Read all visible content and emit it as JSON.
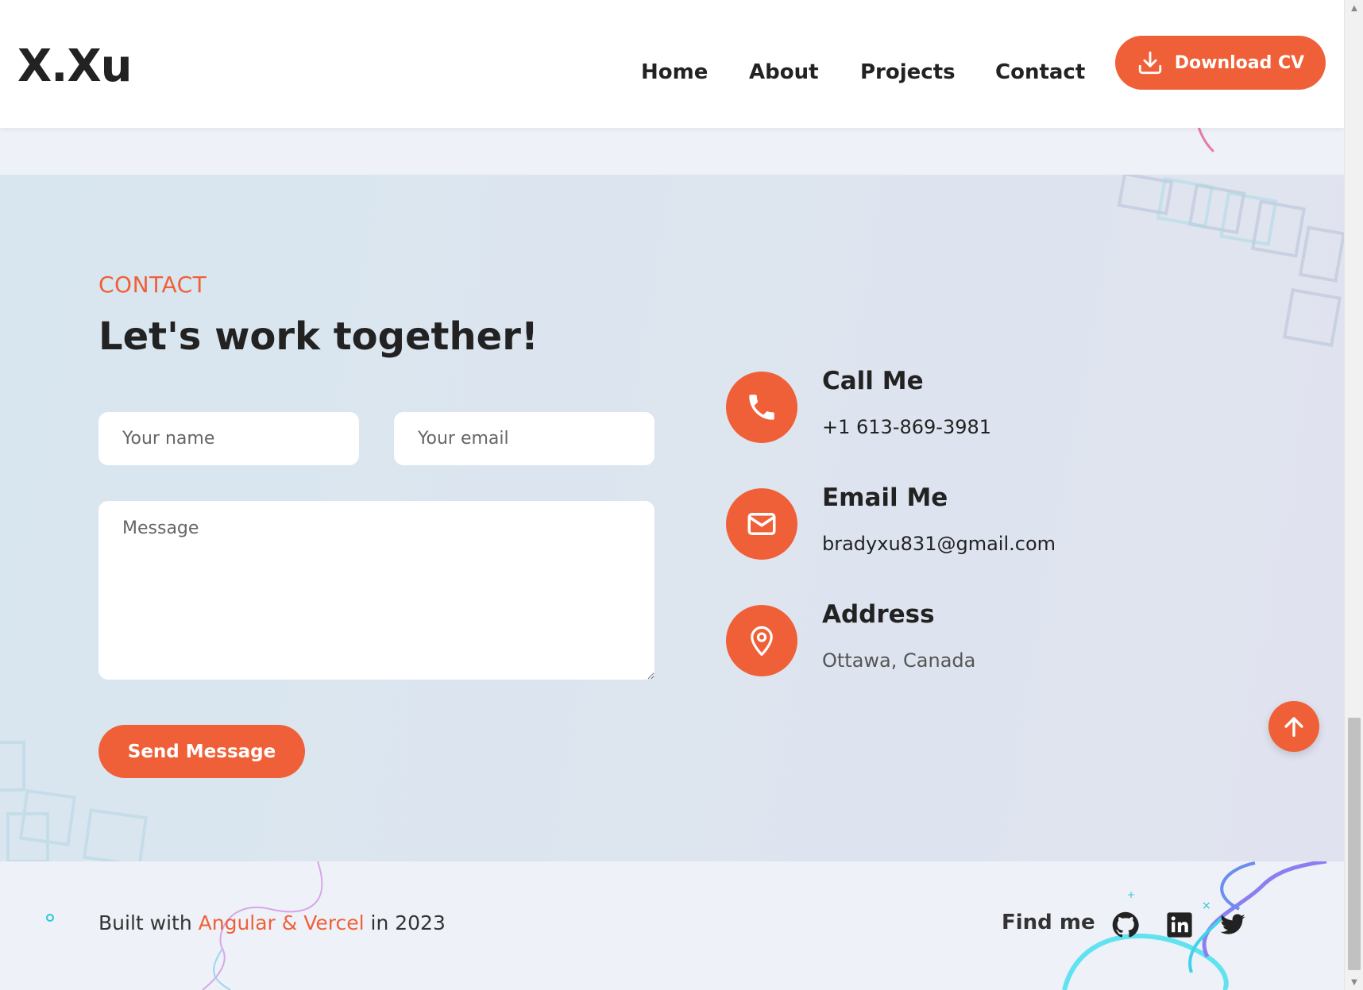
{
  "header": {
    "logo": "X.Xu",
    "nav": [
      "Home",
      "About",
      "Projects",
      "Contact"
    ],
    "cv_button": "Download CV"
  },
  "contact": {
    "eyebrow": "CONTACT",
    "title": "Let's work together!",
    "form": {
      "name_placeholder": "Your name",
      "email_placeholder": "Your email",
      "message_placeholder": "Message",
      "send_label": "Send Message"
    },
    "info": [
      {
        "title": "Call Me",
        "value": "+1 613-869-3981",
        "icon": "phone-icon"
      },
      {
        "title": "Email Me",
        "value": "bradyxu831@gmail.com",
        "icon": "mail-icon"
      },
      {
        "title": "Address",
        "value": "Ottawa, Canada",
        "icon": "location-pin-icon"
      }
    ]
  },
  "footer": {
    "built_prefix": "Built with ",
    "built_tech": "Angular & Vercel",
    "built_suffix": " in 2023",
    "find_me": "Find me",
    "socials": [
      "github-icon",
      "linkedin-icon",
      "twitter-icon"
    ]
  },
  "colors": {
    "accent": "#f06038",
    "text": "#222222",
    "section_bg": "#dde5ef",
    "page_bg": "#eef1f7"
  }
}
